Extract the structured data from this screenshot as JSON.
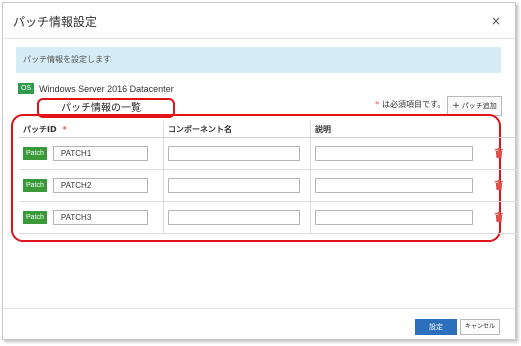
{
  "dialog": {
    "title": "パッチ情報設定",
    "close_glyph": "×",
    "notice": "パッチ情報を設定します",
    "os_badge": "OS",
    "os_name": "Windows Server 2016 Datacenter",
    "callout": "パッチ情報の一覧",
    "required_star": "*",
    "required_text": "は必須項目です。",
    "add_button_plus": "+",
    "add_button_label": "パッチ追加"
  },
  "table": {
    "headers": {
      "patch_id": "パッチID",
      "patch_id_star": "*",
      "component": "コンポーネント名",
      "description": "説明"
    },
    "rows": [
      {
        "badge": "Patch",
        "patch_id": "PATCH1",
        "component": "",
        "description": ""
      },
      {
        "badge": "Patch",
        "patch_id": "PATCH2",
        "component": "",
        "description": ""
      },
      {
        "badge": "Patch",
        "patch_id": "PATCH3",
        "component": "",
        "description": ""
      }
    ]
  },
  "footer": {
    "confirm_label": "設定",
    "cancel_label": "キャンセル"
  },
  "colors": {
    "accent": "#2c6fba",
    "badge_green": "#3a9a3a",
    "notice_bg": "#d6ecf7",
    "annotation_red": "#e0121a",
    "trash_red": "#d9534f"
  },
  "icons": {
    "close": "close-icon",
    "delete": "trash-icon",
    "add": "plus-icon"
  }
}
